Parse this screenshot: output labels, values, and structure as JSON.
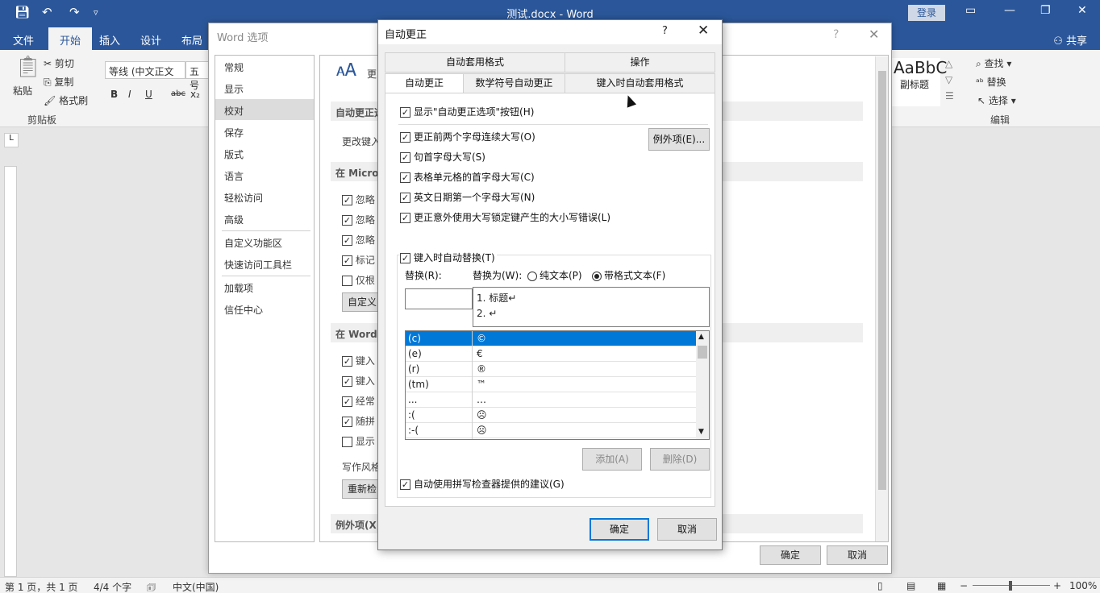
{
  "word": {
    "doc_title": "测试.docx  -  Word",
    "login": "登录",
    "tabs": [
      "文件",
      "开始",
      "插入",
      "设计",
      "布局"
    ],
    "share": "共享",
    "ribbon": {
      "paste": "粘贴",
      "cut": "剪切",
      "copy": "复制",
      "format_painter": "格式刷",
      "clipboard_group": "剪贴板",
      "font_name": "等线 (中文正文",
      "font_size": "五号",
      "bold": "B",
      "italic": "I",
      "underline": "U",
      "strikethrough": "abc",
      "subscript": "x₂",
      "style_preview": "AaBbC",
      "style_name": "副标题",
      "find": "查找",
      "replace": "替换",
      "select": "选择",
      "editing_group": "编辑"
    },
    "ruler_corner": "L",
    "status": {
      "page": "第 1 页，共 1 页",
      "words": "4/4 个字",
      "language": "中文(中国)",
      "zoom": "100%",
      "zoom_minus": "−",
      "zoom_plus": "+"
    }
  },
  "word_options": {
    "title": "Word 选项",
    "help": "?",
    "close": "✕",
    "nav": [
      "常规",
      "显示",
      "校对",
      "保存",
      "版式",
      "语言",
      "轻松访问",
      "高级",
      "自定义功能区",
      "快速访问工具栏",
      "加载项",
      "信任中心"
    ],
    "selected_nav": "校对",
    "content": {
      "sect1": "自动更正选",
      "change_text": "更改键入",
      "sect2": "在 Micros",
      "items_a": [
        "忽略",
        "忽略",
        "忽略",
        "标记",
        "仅根"
      ],
      "custom_btn": "自定义",
      "sect3": "在 Word",
      "items_b": [
        "键入",
        "键入",
        "经常",
        "随拼",
        "显示"
      ],
      "writing_style": "写作风格",
      "recheck_btn": "重新检",
      "exceptions": "例外项(X)",
      "ico_text": "更"
    },
    "ok": "确定",
    "cancel": "取消"
  },
  "autocorrect": {
    "title": "自动更正",
    "help": "?",
    "close": "✕",
    "tabs_row1": [
      "自动套用格式",
      "操作"
    ],
    "tabs_row2": [
      "自动更正",
      "数学符号自动更正",
      "键入时自动套用格式"
    ],
    "show_options_button": "显示\"自动更正选项\"按钮(H)",
    "options": [
      "更正前两个字母连续大写(O)",
      "句首字母大写(S)",
      "表格单元格的首字母大写(C)",
      "英文日期第一个字母大写(N)",
      "更正意外使用大写锁定键产生的大小写错误(L)"
    ],
    "exceptions_btn": "例外项(E)...",
    "replace_as_type": "键入时自动替换(T)",
    "replace_label": "替换(R):",
    "with_label": "替换为(W):",
    "plain_text": "纯文本(P)",
    "formatted_text": "带格式文本(F)",
    "replace_value": "",
    "preview_lines": [
      "1.    标题↵",
      "2.    ↵"
    ],
    "entries": [
      {
        "from": "(c)",
        "to": "©"
      },
      {
        "from": "(e)",
        "to": "€"
      },
      {
        "from": "(r)",
        "to": "®"
      },
      {
        "from": "(tm)",
        "to": "™"
      },
      {
        "from": "...",
        "to": "…"
      },
      {
        "from": ":(",
        "to": "☹"
      },
      {
        "from": ":-(",
        "to": "☹"
      }
    ],
    "add_btn": "添加(A)",
    "delete_btn": "删除(D)",
    "spellcheck_suggest": "自动使用拼写检查器提供的建议(G)",
    "ok": "确定",
    "cancel": "取消"
  }
}
